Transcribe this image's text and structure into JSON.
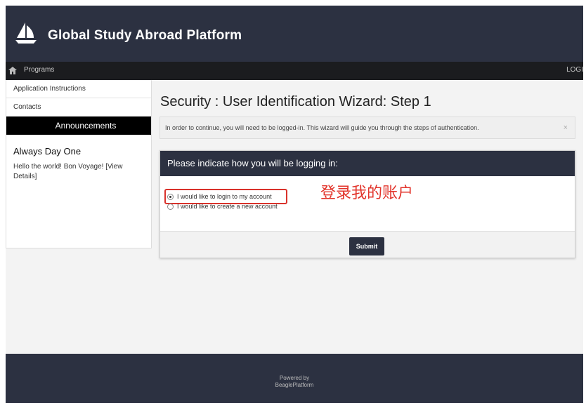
{
  "header": {
    "brand": "Global Study Abroad Platform"
  },
  "nav": {
    "programs": "Programs",
    "login": "LOGI"
  },
  "sidebar": {
    "links": [
      "Application Instructions",
      "Contacts"
    ],
    "announcements_header": "Announcements",
    "announcement_title": "Always Day One",
    "announcement_body": "Hello the world! Bon Voyage! [View Details]"
  },
  "main": {
    "title": "Security : User Identification Wizard: Step 1",
    "alert_text": "In order to continue, you will need to be logged-in. This wizard will guide you through the steps of authentication.",
    "alert_close": "×",
    "panel_title": "Please indicate how you will be logging in:",
    "options": [
      "I would like to login to my account",
      "I would like to create a new account"
    ],
    "selected_option": 0,
    "annotation": "登录我的账户",
    "submit_label": "Submit"
  },
  "footer": {
    "line1": "Powered by",
    "line2": "BeaglePlatform"
  },
  "colors": {
    "header_bg": "#2c3141",
    "navbar_bg": "#1b1c1f",
    "highlight": "#d9322b"
  },
  "icons": {
    "logo": "sailboat-logo",
    "home": "home-icon",
    "close": "close-icon"
  }
}
